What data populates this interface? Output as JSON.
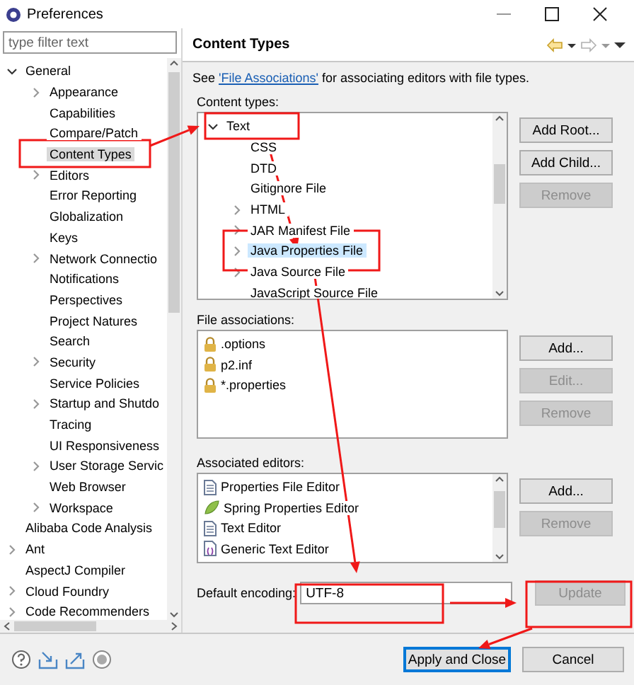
{
  "window": {
    "title": "Preferences"
  },
  "filter": {
    "placeholder": "type filter text"
  },
  "nav_tree": [
    {
      "label": "General",
      "expanded": true,
      "selected": false,
      "children": [
        {
          "label": "Appearance",
          "expanded": false,
          "selected": false
        },
        {
          "label": "Capabilities",
          "selected": false
        },
        {
          "label": "Compare/Patch",
          "selected": false
        },
        {
          "label": "Content Types",
          "selected": true
        },
        {
          "label": "Editors",
          "expanded": false,
          "selected": false
        },
        {
          "label": "Error Reporting",
          "selected": false
        },
        {
          "label": "Globalization",
          "selected": false
        },
        {
          "label": "Keys",
          "selected": false
        },
        {
          "label": "Network Connectio",
          "expanded": false,
          "selected": false
        },
        {
          "label": "Notifications",
          "selected": false
        },
        {
          "label": "Perspectives",
          "selected": false
        },
        {
          "label": "Project Natures",
          "selected": false
        },
        {
          "label": "Search",
          "selected": false
        },
        {
          "label": "Security",
          "expanded": false,
          "selected": false
        },
        {
          "label": "Service Policies",
          "selected": false
        },
        {
          "label": "Startup and Shutdo",
          "expanded": false,
          "selected": false
        },
        {
          "label": "Tracing",
          "selected": false
        },
        {
          "label": "UI Responsiveness",
          "selected": false
        },
        {
          "label": "User Storage Servic",
          "expanded": false,
          "selected": false
        },
        {
          "label": "Web Browser",
          "selected": false
        },
        {
          "label": "Workspace",
          "expanded": false,
          "selected": false
        }
      ]
    },
    {
      "label": "Alibaba Code Analysis",
      "selected": false
    },
    {
      "label": "Ant",
      "expanded": false,
      "selected": false
    },
    {
      "label": "AspectJ Compiler",
      "selected": false
    },
    {
      "label": "Cloud Foundry",
      "expanded": false,
      "selected": false
    },
    {
      "label": "Code Recommenders",
      "expanded": false,
      "selected": false
    }
  ],
  "page": {
    "title": "Content Types",
    "intro_before": "See ",
    "intro_link": "'File Associations'",
    "intro_after": " for associating editors with file types."
  },
  "content_types": {
    "label": "Content types:",
    "tree": [
      {
        "label": "Text",
        "expanded": true,
        "selected": false,
        "children": [
          {
            "label": "CSS",
            "selected": false
          },
          {
            "label": "DTD",
            "selected": false
          },
          {
            "label": "Gitignore File",
            "selected": false
          },
          {
            "label": "HTML",
            "expanded": false,
            "selected": false
          },
          {
            "label": "JAR Manifest File",
            "expanded": false,
            "selected": false
          },
          {
            "label": "Java Properties File",
            "expanded": false,
            "selected": true
          },
          {
            "label": "Java Source File",
            "expanded": false,
            "selected": false
          },
          {
            "label": "JavaScript Source File",
            "selected": false
          }
        ]
      }
    ],
    "buttons": [
      {
        "label": "Add Root...",
        "disabled": false
      },
      {
        "label": "Add Child...",
        "disabled": false
      },
      {
        "label": "Remove",
        "disabled": true
      }
    ]
  },
  "file_associations": {
    "label": "File associations:",
    "items": [
      ".options",
      "p2.inf",
      "*.properties"
    ],
    "buttons": [
      {
        "label": "Add...",
        "disabled": false
      },
      {
        "label": "Edit...",
        "disabled": true
      },
      {
        "label": "Remove",
        "disabled": true
      }
    ]
  },
  "associated_editors": {
    "label": "Associated editors:",
    "items": [
      {
        "label": "Properties File Editor",
        "kind": "document"
      },
      {
        "label": "Spring Properties Editor",
        "kind": "leaf"
      },
      {
        "label": "Text Editor",
        "kind": "document"
      },
      {
        "label": "Generic Text Editor",
        "kind": "generic"
      }
    ],
    "buttons": [
      {
        "label": "Add...",
        "disabled": false
      },
      {
        "label": "Remove",
        "disabled": true
      }
    ]
  },
  "encoding": {
    "label": "Default encoding:",
    "value": "UTF-8",
    "button": {
      "label": "Update",
      "disabled": true
    }
  },
  "footer_buttons": [
    {
      "label": "Apply and Close",
      "default": true
    },
    {
      "label": "Cancel",
      "default": false
    }
  ]
}
